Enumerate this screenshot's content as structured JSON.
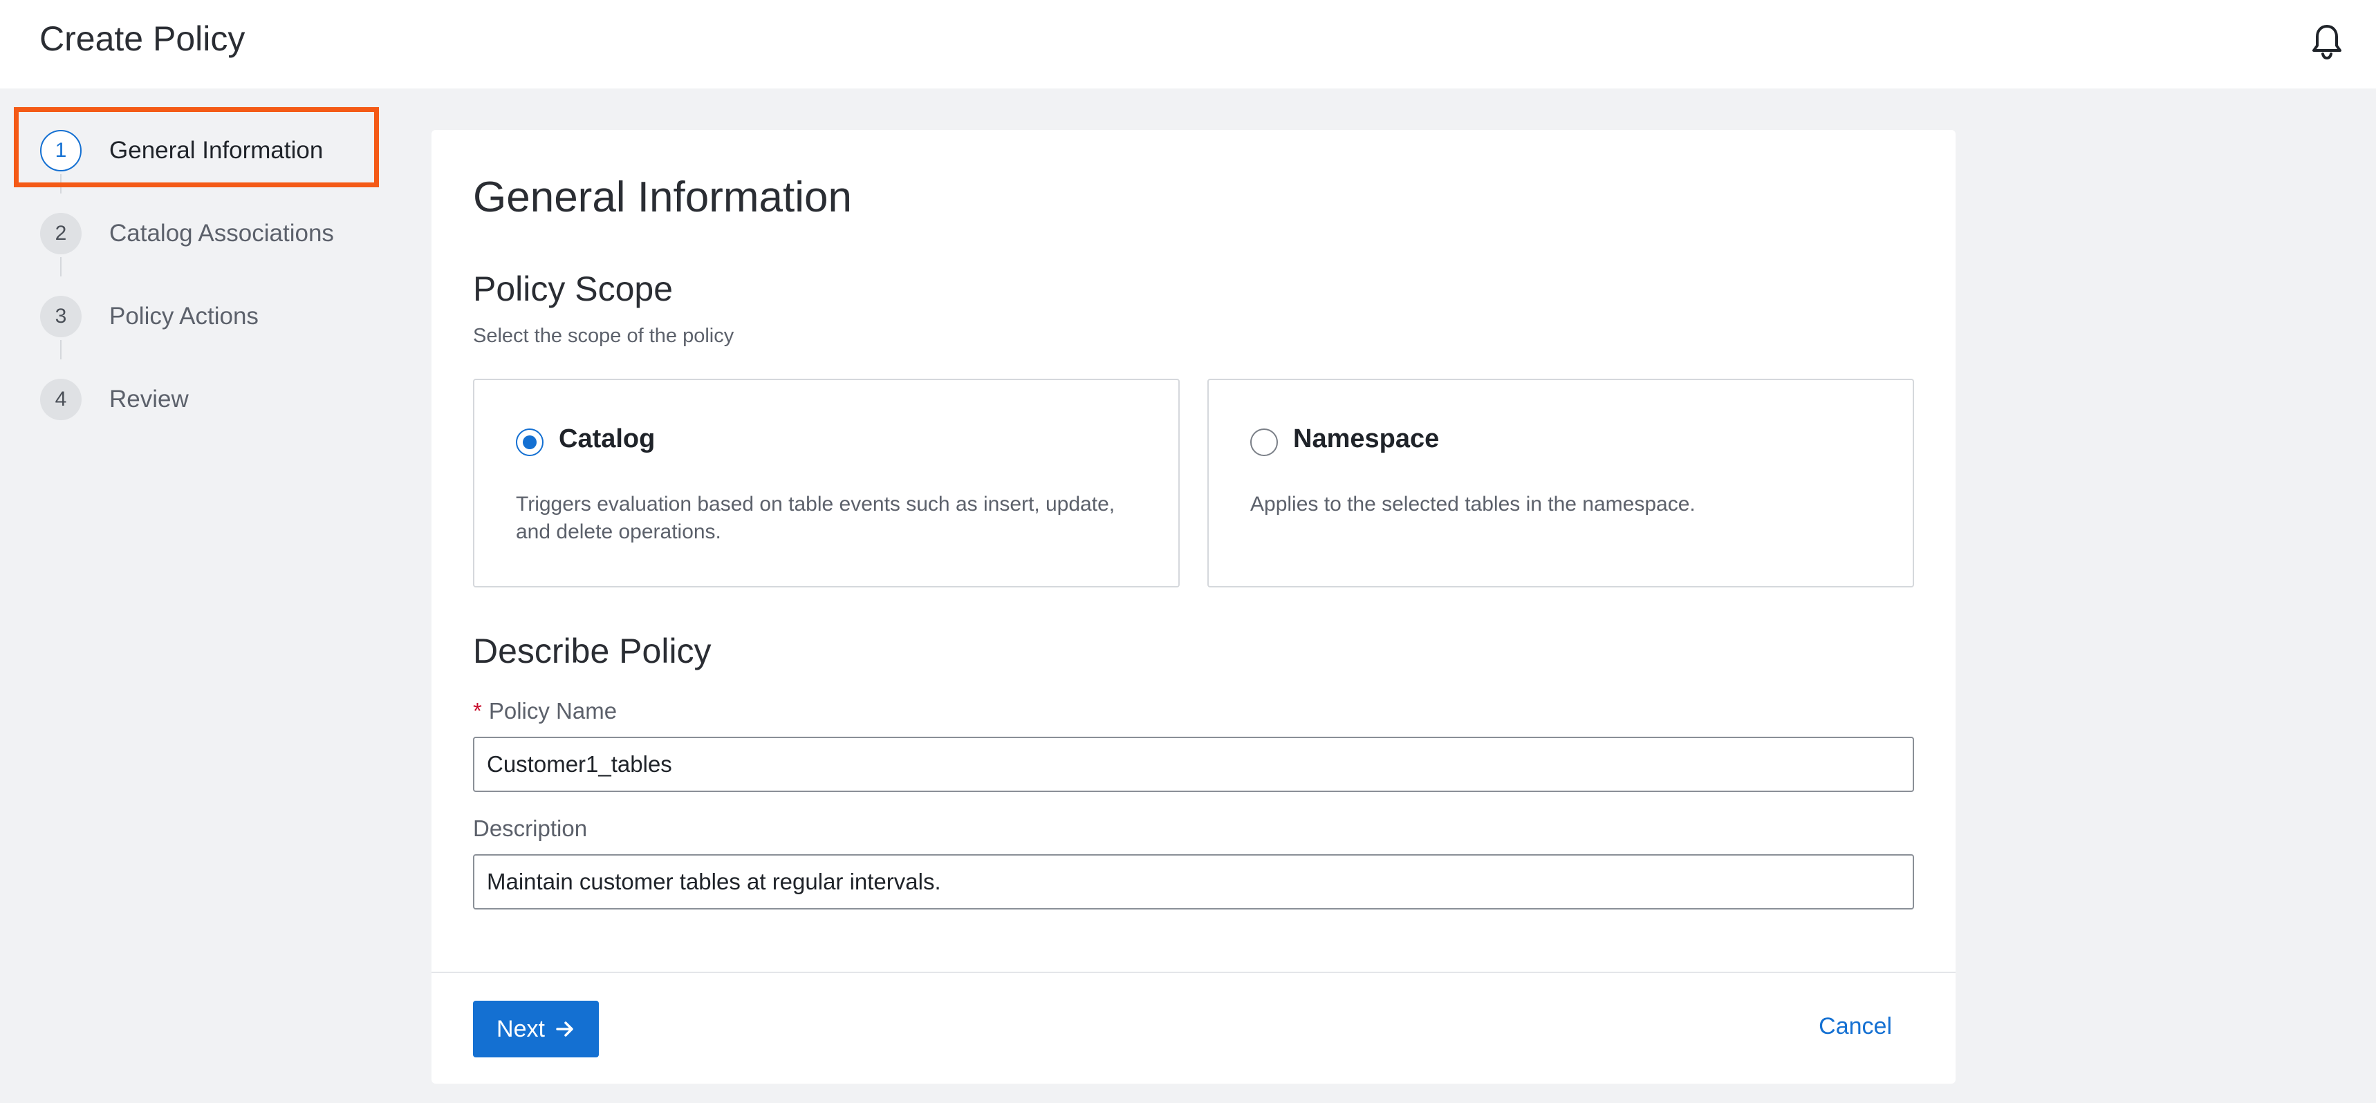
{
  "header": {
    "title": "Create Policy",
    "notification_icon": "bell-icon"
  },
  "steps": [
    {
      "number": "1",
      "label": "General Information",
      "active": true
    },
    {
      "number": "2",
      "label": "Catalog Associations",
      "active": false
    },
    {
      "number": "3",
      "label": "Policy Actions",
      "active": false
    },
    {
      "number": "4",
      "label": "Review",
      "active": false
    }
  ],
  "card": {
    "title": "General Information",
    "scope": {
      "title": "Policy Scope",
      "subtitle": "Select the scope of the policy",
      "options": [
        {
          "name": "Catalog",
          "description": "Triggers evaluation based on table events such as insert, update, and delete operations.",
          "selected": true
        },
        {
          "name": "Namespace",
          "description": "Applies to the selected tables in the namespace.",
          "selected": false
        }
      ]
    },
    "describe": {
      "title": "Describe Policy",
      "required_mark": "*",
      "name_label": "Policy Name",
      "name_value": "Customer1_tables",
      "description_label": "Description",
      "description_value": "Maintain customer tables at regular intervals."
    },
    "footer": {
      "next_label": "Next",
      "next_icon": "arrow-right-icon",
      "cancel_label": "Cancel"
    }
  },
  "colors": {
    "accent": "#1470d2",
    "highlight": "#f45a16",
    "background": "#f1f2f4"
  }
}
